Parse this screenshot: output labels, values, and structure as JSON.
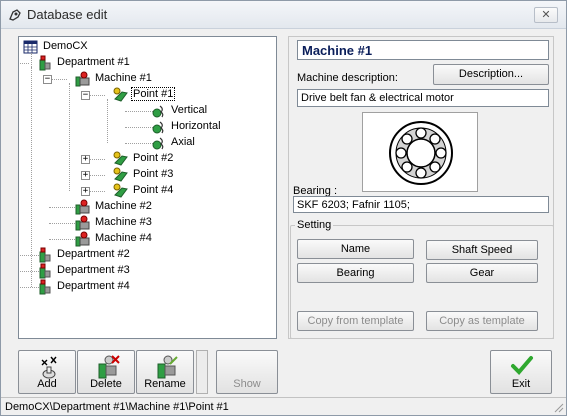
{
  "window": {
    "title": "Database edit",
    "close_glyph": "✕"
  },
  "tree": {
    "root": "DemoCX",
    "nodes": [
      {
        "label": "Department #1",
        "icon": "department-icon",
        "state": "expanded"
      },
      {
        "label": "Machine #1",
        "icon": "machine-icon",
        "state": "expanded"
      },
      {
        "label": "Point #1",
        "icon": "point-icon",
        "state": "expanded",
        "selected": true
      },
      {
        "label": "Vertical",
        "icon": "sensor-icon"
      },
      {
        "label": "Horizontal",
        "icon": "sensor-icon"
      },
      {
        "label": "Axial",
        "icon": "sensor-icon"
      },
      {
        "label": "Point #2",
        "icon": "point-icon",
        "state": "collapsed"
      },
      {
        "label": "Point #3",
        "icon": "point-icon",
        "state": "collapsed"
      },
      {
        "label": "Point #4",
        "icon": "point-icon",
        "state": "collapsed"
      },
      {
        "label": "Machine #2",
        "icon": "machine-icon"
      },
      {
        "label": "Machine #3",
        "icon": "machine-icon"
      },
      {
        "label": "Machine #4",
        "icon": "machine-icon"
      },
      {
        "label": "Department #2",
        "icon": "department-icon"
      },
      {
        "label": "Department #3",
        "icon": "department-icon"
      },
      {
        "label": "Department #4",
        "icon": "department-icon"
      }
    ],
    "expander_plus": "+",
    "expander_minus": "−"
  },
  "detail": {
    "title": "Machine #1",
    "description_label": "Machine description:",
    "description_button": "Description...",
    "description_value": "Drive belt fan & electrical motor",
    "image_icon": "bearing-diagram-icon",
    "bearing_label": "Bearing :",
    "bearing_value": "SKF 6203; Fafnir 1105;"
  },
  "setting": {
    "label": "Setting",
    "buttons": {
      "name": "Name",
      "shaft_speed": "Shaft Speed",
      "bearing": "Bearing",
      "gear": "Gear",
      "copy_from_template": "Copy from template",
      "copy_as_template": "Copy as template"
    }
  },
  "toolbar": {
    "add": "Add",
    "delete": "Delete",
    "rename": "Rename",
    "show": "Show",
    "exit": "Exit"
  },
  "status": {
    "path": "DemoCX\\Department #1\\Machine #1\\Point #1"
  },
  "colors": {
    "accent_title": "#0a1e5a",
    "exit_check": "#2fa82f"
  }
}
